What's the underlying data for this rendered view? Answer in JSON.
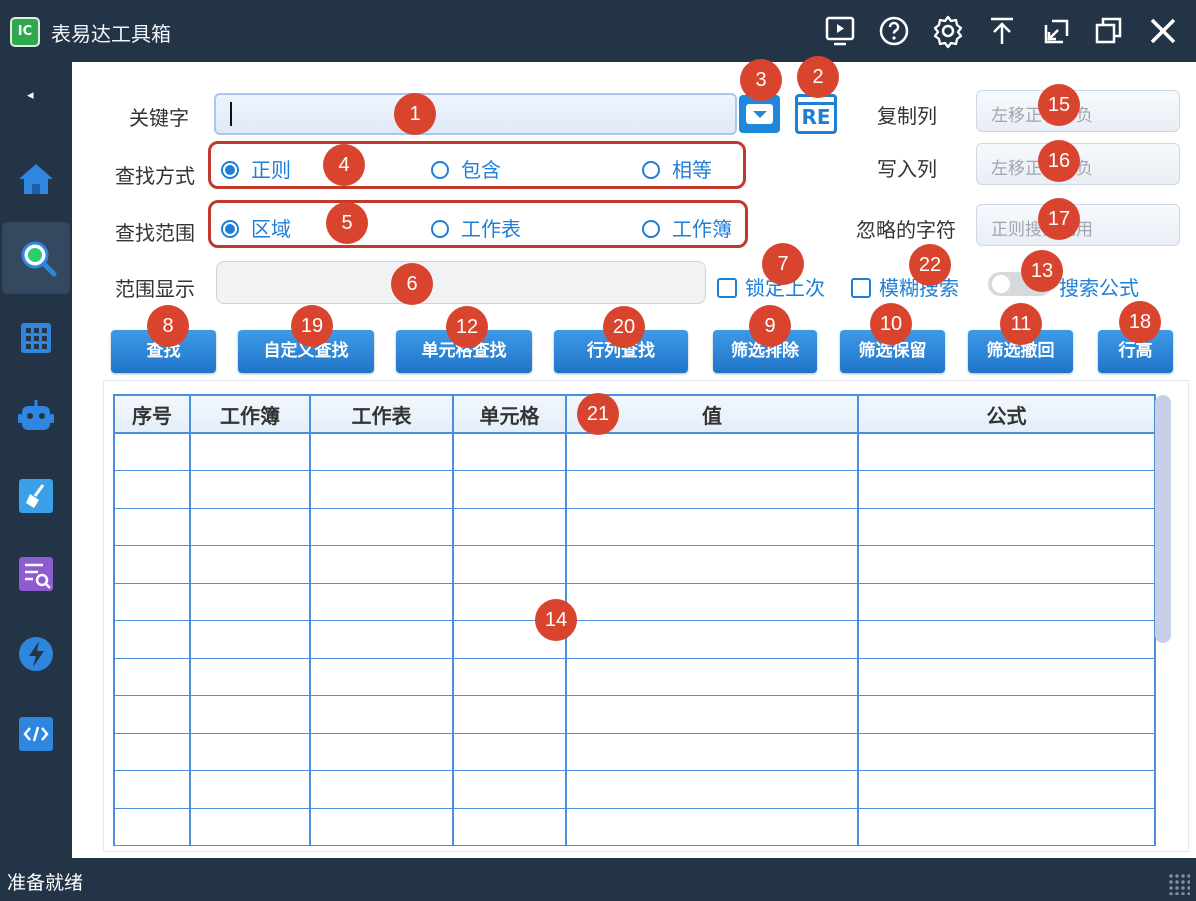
{
  "window": {
    "title": "表易达工具箱",
    "logo_text": "IC",
    "controls": [
      "video-icon",
      "help-icon",
      "settings-icon",
      "pin-top-icon",
      "restore-icon",
      "copy-icon",
      "close-icon"
    ]
  },
  "sidebar": {
    "collapse_symbol": "◂",
    "items": [
      "home-icon",
      "search-icon",
      "grid-icon",
      "robot-icon",
      "clean-icon",
      "list-search-icon",
      "lightning-icon",
      "code-icon"
    ],
    "active": "search-icon"
  },
  "form": {
    "keyword_label": "关键字",
    "keyword_value": "",
    "re_label": "RE",
    "search_mode_label": "查找方式",
    "search_mode_options": [
      "正则",
      "包含",
      "相等"
    ],
    "search_mode_selected": "正则",
    "search_scope_label": "查找范围",
    "search_scope_options": [
      "区域",
      "工作表",
      "工作簿"
    ],
    "search_scope_selected": "区域",
    "range_display_label": "范围显示",
    "range_display_value": "",
    "copy_column_label": "复制列",
    "copy_column_placeholder": "左移正右移负",
    "write_column_label": "写入列",
    "write_column_placeholder": "左移正右移负",
    "ignore_chars_label": "忽略的字符",
    "ignore_chars_placeholder": "正则搜索无用",
    "lock_last_label": "锁定上次",
    "fuzzy_search_label": "模糊搜索",
    "search_formula_label": "搜索公式"
  },
  "buttons": {
    "find": "查找",
    "custom_find": "自定义查找",
    "cell_find": "单元格查找",
    "rowcol_find": "行列查找",
    "filter_exclude": "筛选排除",
    "filter_keep": "筛选保留",
    "filter_undo": "筛选撤回",
    "row_height": "行高"
  },
  "table": {
    "columns": [
      "序号",
      "工作簿",
      "工作表",
      "单元格",
      "值",
      "公式"
    ],
    "rows": [
      [
        "",
        "",
        "",
        "",
        "",
        ""
      ],
      [
        "",
        "",
        "",
        "",
        "",
        ""
      ],
      [
        "",
        "",
        "",
        "",
        "",
        ""
      ],
      [
        "",
        "",
        "",
        "",
        "",
        ""
      ],
      [
        "",
        "",
        "",
        "",
        "",
        ""
      ],
      [
        "",
        "",
        "",
        "",
        "",
        ""
      ],
      [
        "",
        "",
        "",
        "",
        "",
        ""
      ],
      [
        "",
        "",
        "",
        "",
        "",
        ""
      ],
      [
        "",
        "",
        "",
        "",
        "",
        ""
      ],
      [
        "",
        "",
        "",
        "",
        "",
        ""
      ],
      [
        "",
        "",
        "",
        "",
        "",
        ""
      ]
    ]
  },
  "status": {
    "text": "准备就绪"
  },
  "markers": [
    "1",
    "2",
    "3",
    "4",
    "5",
    "6",
    "7",
    "8",
    "9",
    "10",
    "11",
    "12",
    "13",
    "14",
    "15",
    "16",
    "17",
    "18",
    "19",
    "20",
    "21",
    "22"
  ],
  "colors": {
    "chrome": "#243447",
    "accent": "#1f7fd6",
    "marker": "#d9442e",
    "highlight_border": "#c0392b"
  }
}
